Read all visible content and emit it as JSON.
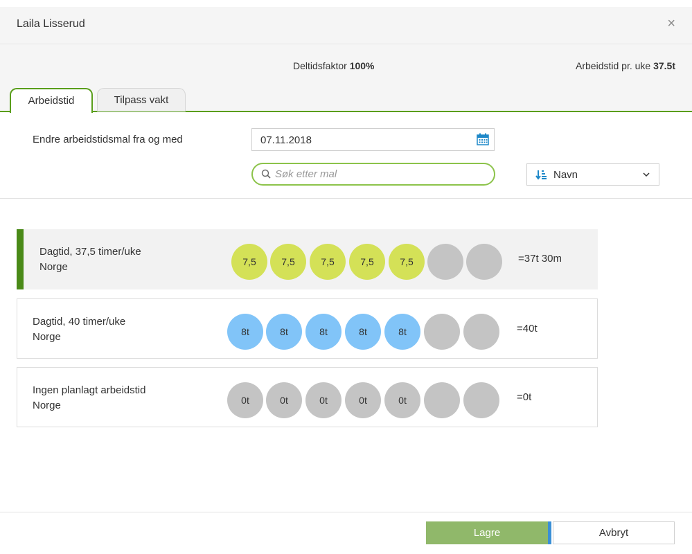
{
  "dialog": {
    "title": "Laila Lisserud",
    "close_icon": "close-icon",
    "close_glyph": "×"
  },
  "info": {
    "factor_label": "Deltidsfaktor",
    "factor_value": "100%",
    "weekly_label": "Arbeidstid pr. uke",
    "weekly_value": "37.5t"
  },
  "tabs": [
    {
      "label": "Arbeidstid",
      "active": true
    },
    {
      "label": "Tilpass vakt",
      "active": false
    }
  ],
  "form": {
    "date_label": "Endre arbeidstidsmal fra og med",
    "date_value": "07.11.2018",
    "search_placeholder": "Søk etter mal",
    "sort_label": "Navn"
  },
  "colors": {
    "accent_green": "#5a9e1c",
    "selected_bar": "#4a8a18",
    "yellow_day": "#d4e157",
    "blue_day": "#81c4f8",
    "empty_day": "#c4c4c4",
    "save_button": "#90b86a",
    "save_focus": "#3a8fd6"
  },
  "templates": [
    {
      "name": "Dagtid, 37,5 timer/uke",
      "country": "Norge",
      "selected": true,
      "days": [
        {
          "label": "7,5",
          "type": "yellow"
        },
        {
          "label": "7,5",
          "type": "yellow"
        },
        {
          "label": "7,5",
          "type": "yellow"
        },
        {
          "label": "7,5",
          "type": "yellow"
        },
        {
          "label": "7,5",
          "type": "yellow"
        },
        {
          "label": "",
          "type": "empty"
        },
        {
          "label": "",
          "type": "empty"
        }
      ],
      "total": "=37t 30m"
    },
    {
      "name": "Dagtid, 40 timer/uke",
      "country": "Norge",
      "selected": false,
      "days": [
        {
          "label": "8t",
          "type": "blue"
        },
        {
          "label": "8t",
          "type": "blue"
        },
        {
          "label": "8t",
          "type": "blue"
        },
        {
          "label": "8t",
          "type": "blue"
        },
        {
          "label": "8t",
          "type": "blue"
        },
        {
          "label": "",
          "type": "empty"
        },
        {
          "label": "",
          "type": "empty"
        }
      ],
      "total": "=40t"
    },
    {
      "name": "Ingen planlagt arbeidstid",
      "country": "Norge",
      "selected": false,
      "days": [
        {
          "label": "0t",
          "type": "empty"
        },
        {
          "label": "0t",
          "type": "empty"
        },
        {
          "label": "0t",
          "type": "empty"
        },
        {
          "label": "0t",
          "type": "empty"
        },
        {
          "label": "0t",
          "type": "empty"
        },
        {
          "label": "",
          "type": "empty"
        },
        {
          "label": "",
          "type": "empty"
        }
      ],
      "total": "=0t"
    }
  ],
  "footer": {
    "save_label": "Lagre",
    "cancel_label": "Avbryt"
  }
}
